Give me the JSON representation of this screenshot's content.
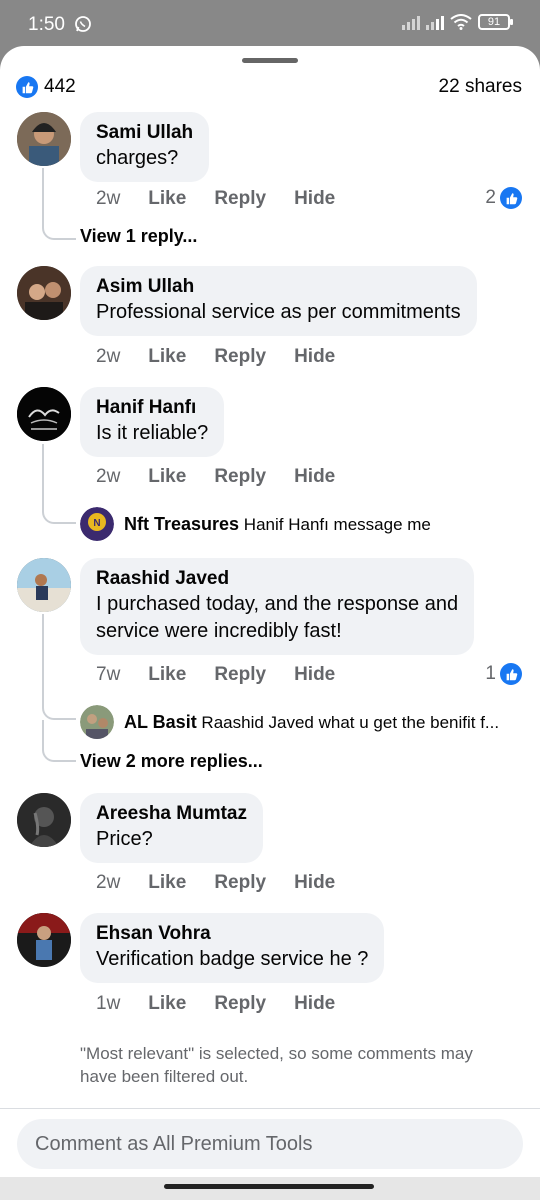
{
  "status_bar": {
    "time": "1:50",
    "battery": "91"
  },
  "reactions": {
    "count": "442",
    "shares": "22 shares"
  },
  "comments": [
    {
      "author": "Sami Ullah",
      "text": "charges?",
      "time": "2w",
      "like": "Like",
      "reply": "Reply",
      "hide": "Hide",
      "likes": "2",
      "view_replies": "View 1 reply..."
    },
    {
      "author": "Asim Ullah",
      "text": "Professional service as per commitments",
      "time": "2w",
      "like": "Like",
      "reply": "Reply",
      "hide": "Hide"
    },
    {
      "author": "Hanif Hanfı",
      "text": "Is it reliable?",
      "time": "2w",
      "like": "Like",
      "reply": "Reply",
      "hide": "Hide",
      "reply_preview": {
        "author": "Nft Treasures",
        "text": "Hanif Hanfı message me"
      }
    },
    {
      "author": "Raashid Javed",
      "text_line1": "I purchased today, and the response and",
      "text_line2": "service were incredibly fast!",
      "time": "7w",
      "like": "Like",
      "reply": "Reply",
      "hide": "Hide",
      "likes": "1",
      "reply_preview": {
        "author": "AL Basit",
        "text": "Raashid Javed what u get the benifit f..."
      },
      "view_replies": "View 2 more replies..."
    },
    {
      "author": "Areesha Mumtaz",
      "text": "Price?",
      "time": "2w",
      "like": "Like",
      "reply": "Reply",
      "hide": "Hide"
    },
    {
      "author": "Ehsan Vohra",
      "text": "Verification badge service he ?",
      "time": "1w",
      "like": "Like",
      "reply": "Reply",
      "hide": "Hide"
    }
  ],
  "filter_note": "\"Most relevant\" is selected, so some comments may have been filtered out.",
  "composer": {
    "placeholder": "Comment as All Premium Tools"
  },
  "colors": {
    "accent": "#1877f2",
    "bubble": "#f0f2f5",
    "secondary_text": "#65676b"
  }
}
